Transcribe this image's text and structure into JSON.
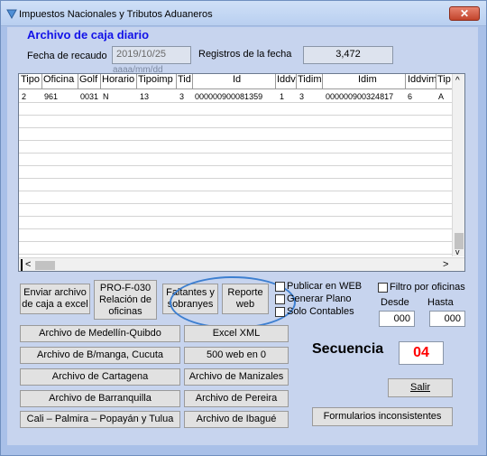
{
  "window": {
    "title": "Impuestos Nacionales y Tributos Aduaneros",
    "close_glyph": "✕"
  },
  "heading": "Archivo de caja diario",
  "fecha_recaudo": {
    "label": "Fecha de recaudo",
    "value": "2019/10/25",
    "hint": "aaaa/mm/dd"
  },
  "registros": {
    "label": "Registros de la fecha",
    "value": "3,472"
  },
  "grid": {
    "columns": [
      "Tipo",
      "Oficina",
      "Golf",
      "Horario",
      "Tipoimp",
      "Tid",
      "Id",
      "Iddv",
      "Tidim",
      "Idim",
      "Iddvim",
      "Tip"
    ],
    "rows": [
      [
        "2",
        "961",
        "0031",
        "N",
        "13",
        "3",
        "000000900081359",
        "1",
        "3",
        "000000900324817",
        "6",
        "A"
      ]
    ],
    "scroll_up": "^",
    "scroll_down": "v",
    "scroll_left": "<",
    "scroll_right": ">"
  },
  "buttons": {
    "enviar_line1": "Enviar archivo",
    "enviar_line2": "de caja a excel",
    "pro_line1": "PRO-F-030",
    "pro_line2": "Relación de",
    "pro_line3": "oficinas",
    "faltantes_line1": "Faltantes y",
    "faltantes_line2": "sobranyes",
    "reporte_line1": "Reporte",
    "reporte_line2": "web",
    "medellin": "Archivo de Medellín-Quibdo",
    "bmanga": "Archivo de B/manga, Cucuta",
    "cartagena": "Archivo de Cartagena",
    "barranquilla": "Archivo de Barranquilla",
    "cali": "Cali – Palmira – Popayán y Tulua",
    "excel_xml": "Excel XML",
    "web500": "500 web en 0",
    "manizales": "Archivo de Manizales",
    "pereira": "Archivo de Pereira",
    "ibague": "Archivo de Ibagué",
    "salir": "Salir",
    "formularios": "Formularios inconsistentes"
  },
  "checkboxes": {
    "publicar": "Publicar en WEB",
    "generar": "Generar Plano",
    "solo": "Solo Contables",
    "filtro": "Filtro por oficinas"
  },
  "rango": {
    "desde_label": "Desde",
    "hasta_label": "Hasta",
    "desde_value": "000",
    "hasta_value": "000"
  },
  "secuencia": {
    "label": "Secuencia",
    "value": "04"
  },
  "colors": {
    "heading": "#1212e8",
    "secuencia_value": "#ff0000",
    "highlight": "#3d7fd0"
  }
}
